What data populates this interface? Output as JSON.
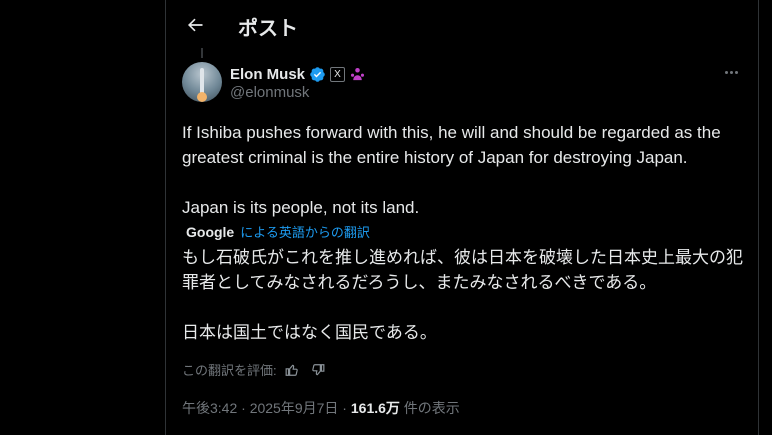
{
  "header": {
    "title": "ポスト"
  },
  "author": {
    "name": "Elon Musk",
    "handle": "@elonmusk",
    "xbadge": "X"
  },
  "post": {
    "text": "If Ishiba pushes forward with this, he will and should be regarded as the\ngreatest criminal is the entire history of Japan for destroying Japan.\n\nJapan is its people, not its land."
  },
  "translation": {
    "provider": "Google",
    "label": "による英語からの翻訳",
    "text": "もし石破氏がこれを推し進めれば、彼は日本を破壊した日本史上最大の犯\n罪者としてみなされるだろうし、またみなされるべきである。\n\n日本は国土ではなく国民である。",
    "rate_label": "この翻訳を評価:"
  },
  "meta": {
    "time": "午後3:42",
    "separator1": " · ",
    "date": "2025年9月7日",
    "separator2": " · ",
    "views": "161.6万",
    "views_label": " 件の表示"
  },
  "colors": {
    "accent": "#1d9bf0",
    "verified": "#1d9bf0",
    "affiliate": "#c040c8",
    "muted": "#71767b"
  }
}
